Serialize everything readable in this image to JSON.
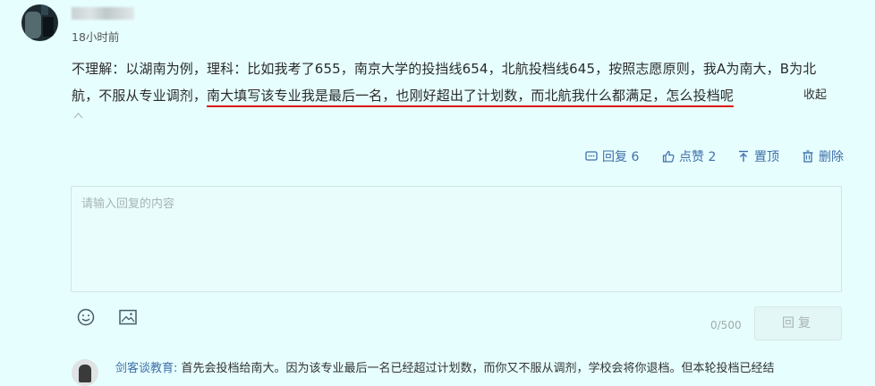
{
  "comment": {
    "author": "",
    "timestamp": "18小时前",
    "text_part1": "不理解：以湖南为例，理科：比如我考了655，南京大学的投挡线654，北航投档线645，按照志愿原则，我A为南大，B为北航，不服从专业调剂，",
    "text_highlight1": "南大填写该专业我是最后一名，也刚好超出了计划数，",
    "text_highlight2": "而北航我什么都满足，怎么投档呢",
    "collapse_label": "收起"
  },
  "actions": {
    "reply_label": "回复 6",
    "like_label": "点赞 2",
    "pin_label": "置顶",
    "delete_label": "删除"
  },
  "reply_box": {
    "placeholder": "请输入回复的内容",
    "counter": "0/500",
    "submit_label": "回复"
  },
  "sub_reply": {
    "author": "剑客谈教育:",
    "text": " 首先会投档给南大。因为该专业最后一名已经超过计划数，而你又不服从调剂，学校会将你退档。但本轮投档已经结"
  },
  "colors": {
    "background": "#e6fefe",
    "link": "#3f6fa8",
    "highlight_underline": "#dd1111"
  },
  "icons": [
    "chevron-up-icon",
    "comment-icon",
    "thumbs-up-icon",
    "pin-top-icon",
    "trash-icon",
    "emoji-icon",
    "image-icon"
  ]
}
